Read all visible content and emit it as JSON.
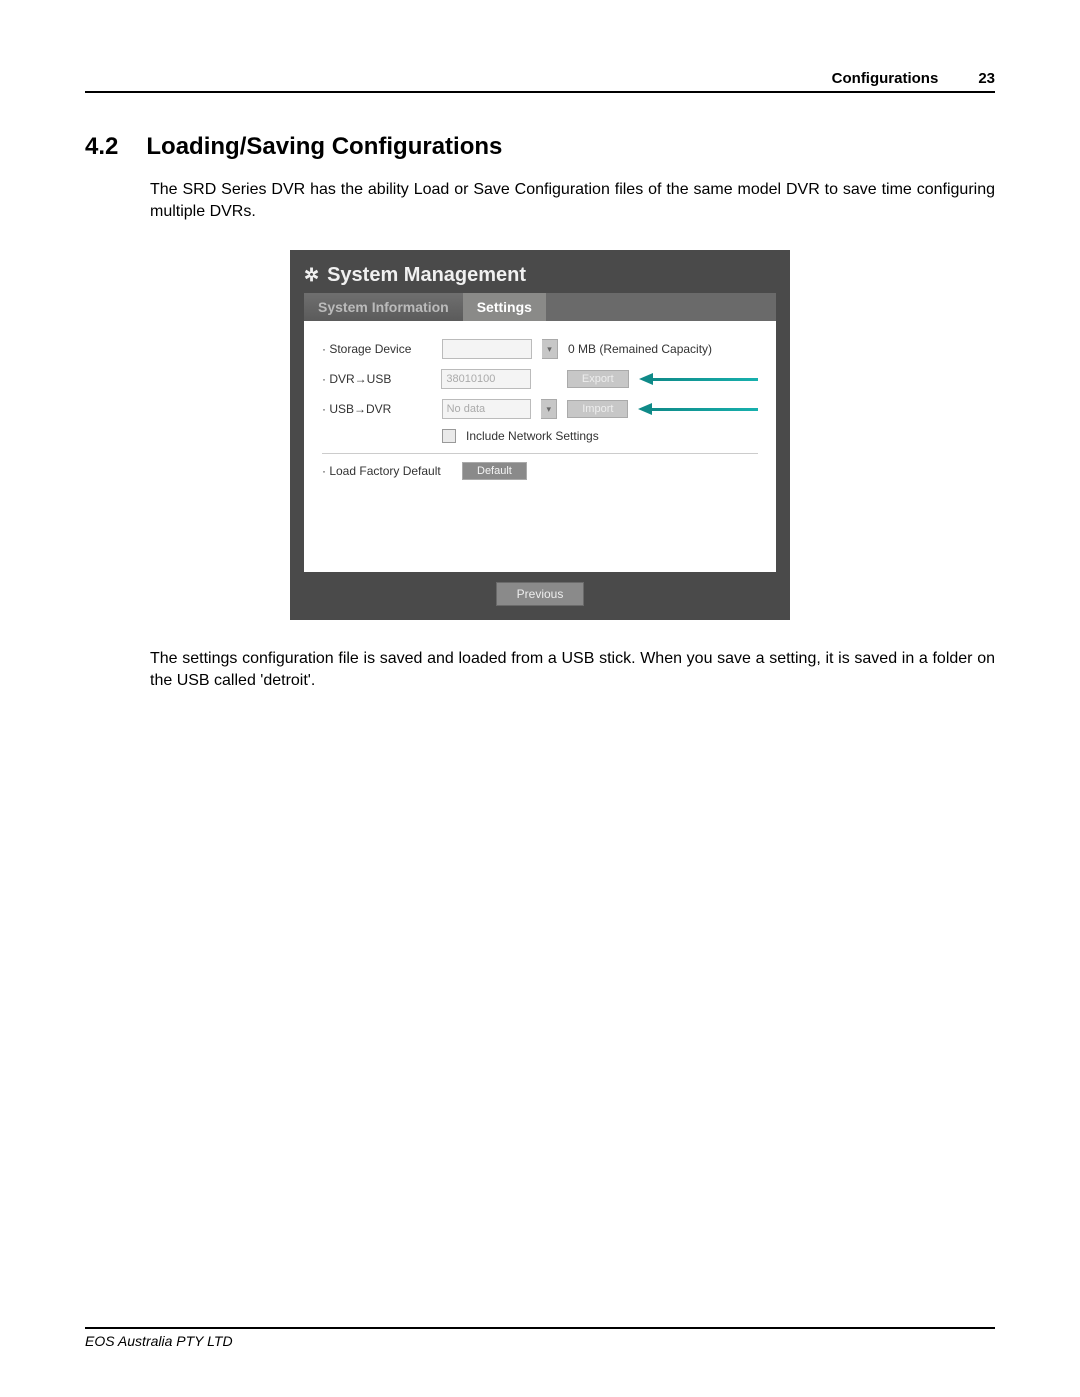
{
  "header": {
    "title": "Configurations",
    "page_number": "23"
  },
  "section": {
    "number": "4.2",
    "title": "Loading/Saving Configurations"
  },
  "intro_text": "The SRD Series DVR has the ability Load or Save Configuration files of the same model DVR to save time configuring multiple DVRs.",
  "outro_text": "The settings configuration file is saved and loaded from a USB stick. When you save a setting, it is saved in a folder on the USB called 'detroit'.",
  "ui": {
    "window_title": "System Management",
    "tabs": {
      "inactive": "System Information",
      "active": "Settings"
    },
    "rows": {
      "storage_device_label": "· Storage Device",
      "storage_device_capacity": "0 MB (Remained Capacity)",
      "dvr_usb_label": "· DVR→USB",
      "dvr_usb_value": "38010100",
      "export_btn": "Export",
      "usb_dvr_label": "· USB→DVR",
      "usb_dvr_value": "No data",
      "import_btn": "Import",
      "include_net_label": "Include Network Settings",
      "factory_label": "· Load Factory Default",
      "default_btn": "Default"
    },
    "footer_btn": "Previous"
  },
  "footer": {
    "org": "EOS Australia PTY LTD"
  }
}
